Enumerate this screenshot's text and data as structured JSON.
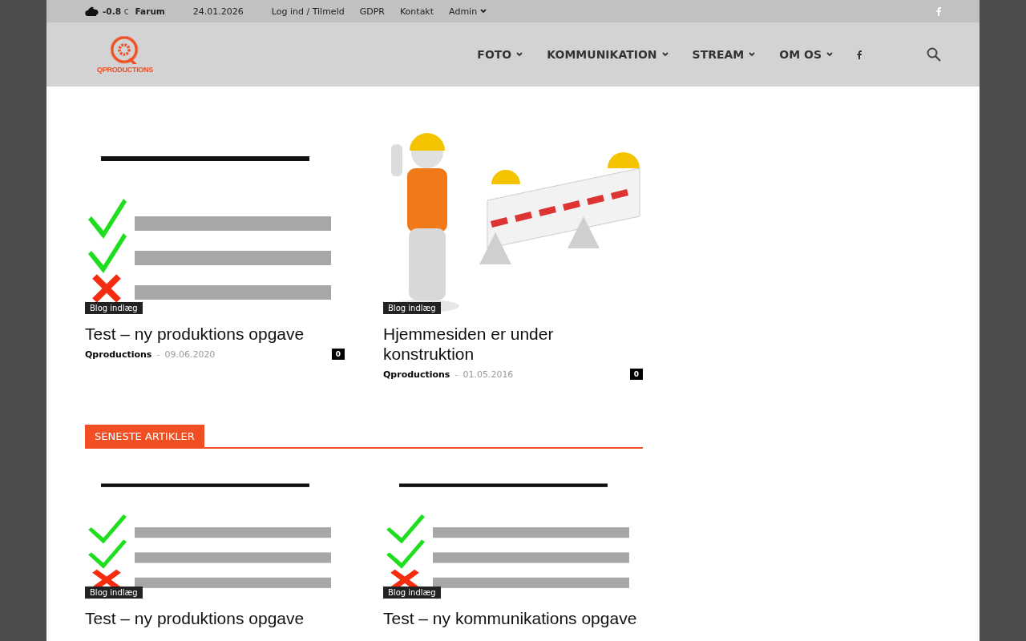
{
  "top_bar": {
    "weather": {
      "temperature": "-0.8",
      "unit": "C",
      "location": "Farum"
    },
    "date": "24.01.2026",
    "links": [
      {
        "label": "Log ind / Tilmeld",
        "has_menu": false
      },
      {
        "label": "GDPR",
        "has_menu": false
      },
      {
        "label": "Kontakt",
        "has_menu": false
      },
      {
        "label": "Admin",
        "has_menu": true
      }
    ]
  },
  "header": {
    "logo_text": "QPRODUCTIONS",
    "nav": [
      {
        "label": "FOTO",
        "has_menu": true
      },
      {
        "label": "KOMMUNIKATION",
        "has_menu": true
      },
      {
        "label": "STREAM",
        "has_menu": true
      },
      {
        "label": "OM OS",
        "has_menu": true
      }
    ]
  },
  "featured_posts": [
    {
      "category": "Blog indlæg",
      "title": "Test – ny produktions opgave",
      "author": "Qproductions",
      "separator": "-",
      "date": "09.06.2020",
      "comments": "0"
    },
    {
      "category": "Blog indlæg",
      "title": "Hjemmesiden er under konstruktion",
      "author": "Qproductions",
      "separator": "-",
      "date": "01.05.2016",
      "comments": "0"
    }
  ],
  "latest_section": {
    "title": "SENESTE ARTIKLER",
    "posts": [
      {
        "category": "Blog indlæg",
        "title": "Test – ny produktions opgave"
      },
      {
        "category": "Blog indlæg",
        "title": "Test – ny kommunikations opgave"
      }
    ]
  }
}
